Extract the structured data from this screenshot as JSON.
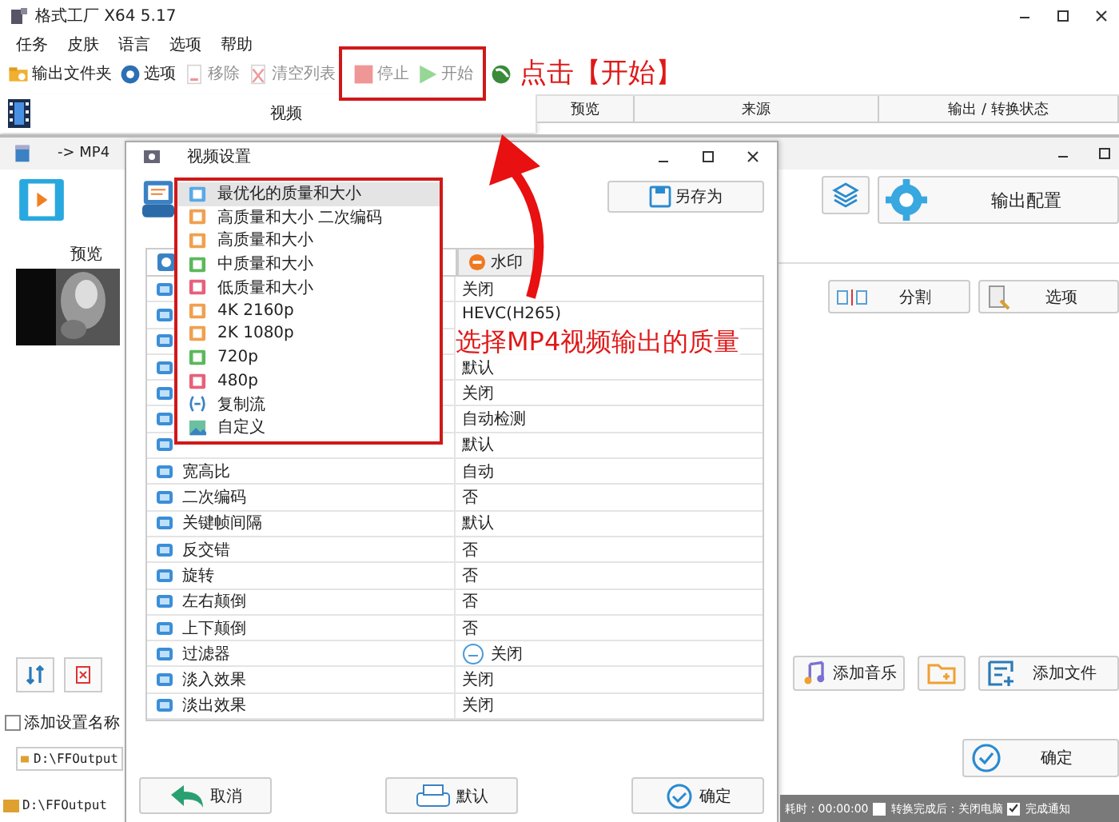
{
  "window": {
    "title": "格式工厂 X64 5.17"
  },
  "menu": [
    "任务",
    "皮肤",
    "语言",
    "选项",
    "帮助"
  ],
  "toolbar": [
    {
      "kind": "folder",
      "label": "输出文件夹",
      "disabled": false
    },
    {
      "kind": "options",
      "label": "选项",
      "disabled": false
    },
    {
      "kind": "remove",
      "label": "移除",
      "disabled": true
    },
    {
      "kind": "clear",
      "label": "清空列表",
      "disabled": true
    },
    {
      "kind": "stop",
      "label": "停止",
      "disabled": true
    },
    {
      "kind": "start",
      "label": "开始",
      "disabled": true
    },
    {
      "kind": "globe",
      "disabled": false
    }
  ],
  "task_panel": {
    "label": "视频"
  },
  "task_table": {
    "columns": [
      "预览",
      "来源",
      "输出 / 转换状态"
    ]
  },
  "callout_start": "点击【开始】",
  "callout_quality": "选择MP4视频输出的质量",
  "output_window": {
    "title": "-> MP4",
    "preview_label": "预览",
    "add_setting_name": {
      "label": "添加设置名称",
      "checked": false
    },
    "output_folder": "D:\\FFOutput",
    "output_config": "输出配置",
    "split": "分割",
    "options": "选项",
    "add_music": "添加音乐",
    "add_file": "添加文件",
    "ok": "确定"
  },
  "dialog": {
    "title": "视频设置",
    "save_as": "另存为",
    "tabs": [
      {
        "selected": true
      },
      {
        "label": "水印",
        "selected": false
      }
    ],
    "rows": [
      {
        "kind": "plain",
        "value": "关闭"
      },
      {
        "kind": "plain",
        "value": "HEVC(H265)"
      },
      {
        "kind": "plain"
      },
      {
        "kind": "plain",
        "value": "默认"
      },
      {
        "kind": "plain",
        "value": "关闭"
      },
      {
        "kind": "plain",
        "value": "自动检测"
      },
      {
        "kind": "plain",
        "value": "默认"
      },
      {
        "kind": "plain",
        "label": "宽高比",
        "value": "自动"
      },
      {
        "kind": "plain",
        "label": "二次编码",
        "value": "否"
      },
      {
        "kind": "plain",
        "label": "关键帧间隔",
        "value": "默认"
      },
      {
        "kind": "plain",
        "label": "反交错",
        "value": "否"
      },
      {
        "kind": "plain",
        "label": "旋转",
        "value": "否"
      },
      {
        "kind": "plain",
        "label": "左右颠倒",
        "value": "否"
      },
      {
        "kind": "plain",
        "label": "上下颠倒",
        "value": "否"
      },
      {
        "kind": "toggle",
        "label": "过滤器",
        "value": "关闭"
      },
      {
        "kind": "plain",
        "label": "淡入效果",
        "value": "关闭"
      },
      {
        "kind": "plain",
        "label": "淡出效果",
        "value": "关闭"
      }
    ],
    "quality_list": [
      {
        "kind": "profile",
        "color": "#5aa9e6",
        "label": "最优化的质量和大小",
        "selected": true
      },
      {
        "kind": "profile",
        "color": "#f0a050",
        "label": "高质量和大小 二次编码",
        "selected": false
      },
      {
        "kind": "profile",
        "color": "#f0a050",
        "label": "高质量和大小",
        "selected": false
      },
      {
        "kind": "profile",
        "color": "#5cb85c",
        "label": "中质量和大小",
        "selected": false
      },
      {
        "kind": "profile",
        "color": "#e8607a",
        "label": "低质量和大小",
        "selected": false
      },
      {
        "kind": "profile",
        "color": "#f0a050",
        "label": "4K 2160p",
        "selected": false
      },
      {
        "kind": "profile",
        "color": "#f0a050",
        "label": "2K 1080p",
        "selected": false
      },
      {
        "kind": "profile",
        "color": "#5cb85c",
        "label": "720p",
        "selected": false
      },
      {
        "kind": "profile",
        "color": "#e8607a",
        "label": "480p",
        "selected": false
      },
      {
        "kind": "stream",
        "color": "#3b82c4",
        "label": "复制流",
        "selected": false
      },
      {
        "kind": "custom",
        "color": "#6cc0a0",
        "label": "自定义",
        "selected": false
      }
    ],
    "buttons": [
      "取消",
      "默认",
      "确定"
    ]
  },
  "status_bar": {
    "elapsed": "耗时 : 00:00:00",
    "options": [
      {
        "label": "转换完成后：关闭电脑",
        "checked": false
      },
      {
        "label": "完成通知",
        "checked": true
      }
    ]
  },
  "bottom_path": "D:\\FFOutput"
}
